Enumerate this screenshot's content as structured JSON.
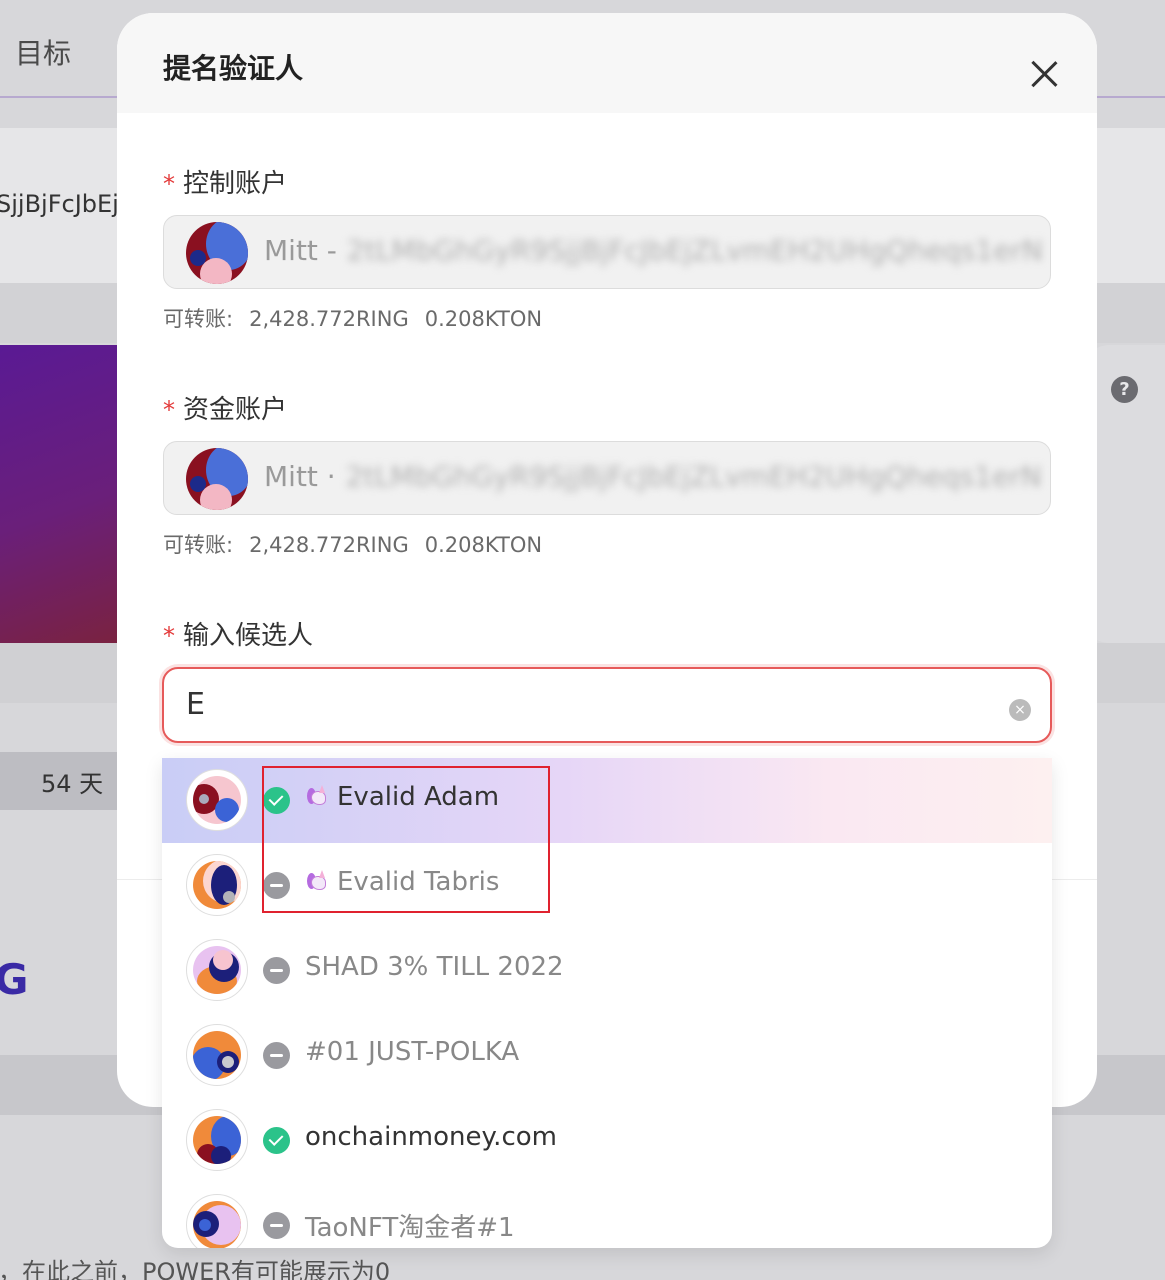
{
  "background": {
    "tab_label": "目标",
    "address_fragment": "SjjBjFcJbEj",
    "days_label": "54 天",
    "partial_text": "G",
    "footer_text": "，在此之前，POWER有可能展示为0",
    "help_icon": "question-icon"
  },
  "modal": {
    "title": "提名验证人",
    "close_icon": "close-icon",
    "controller": {
      "label": "控制账户",
      "required_mark": "*",
      "account_name": "Mitt -",
      "account_address": "2tLMbGhGyR9SjjBjFcJbEjZLvmEH2UHgQheqs1erN",
      "balance_label": "可转账:",
      "ring": "2,428.772RING",
      "kton": "0.208KTON"
    },
    "stash": {
      "label": "资金账户",
      "required_mark": "*",
      "account_name": "Mitt ·",
      "account_address": "2tLMbGhGyR9SjjBjFcJbEjZLvmEH2UHgQheqs1erN",
      "balance_label": "可转账:",
      "ring": "2,428.772RING",
      "kton": "0.208KTON"
    },
    "candidate": {
      "label": "输入候选人",
      "required_mark": "*",
      "value": "E",
      "clear_icon": "clear-icon"
    }
  },
  "dropdown": {
    "items": [
      {
        "name": "Evalid Adam",
        "verified": true,
        "emoji": "unicorn-icon",
        "active": true
      },
      {
        "name": "Evalid Tabris",
        "verified": false,
        "emoji": "unicorn-icon",
        "active": false
      },
      {
        "name": "SHAD 3% TILL 2022",
        "verified": false,
        "active": false
      },
      {
        "name": "#01 JUST-POLKA",
        "verified": false,
        "active": false
      },
      {
        "name": "onchainmoney.com",
        "verified": true,
        "active": false
      },
      {
        "name": "TaoNFT淘金者#1",
        "verified": false,
        "active": false
      }
    ]
  },
  "colors": {
    "required": "#e33a3a",
    "verified": "#2bc38a",
    "unverified": "#9a9a9f",
    "input_error_border": "#e65a5a",
    "highlight_box": "#e0222f"
  }
}
